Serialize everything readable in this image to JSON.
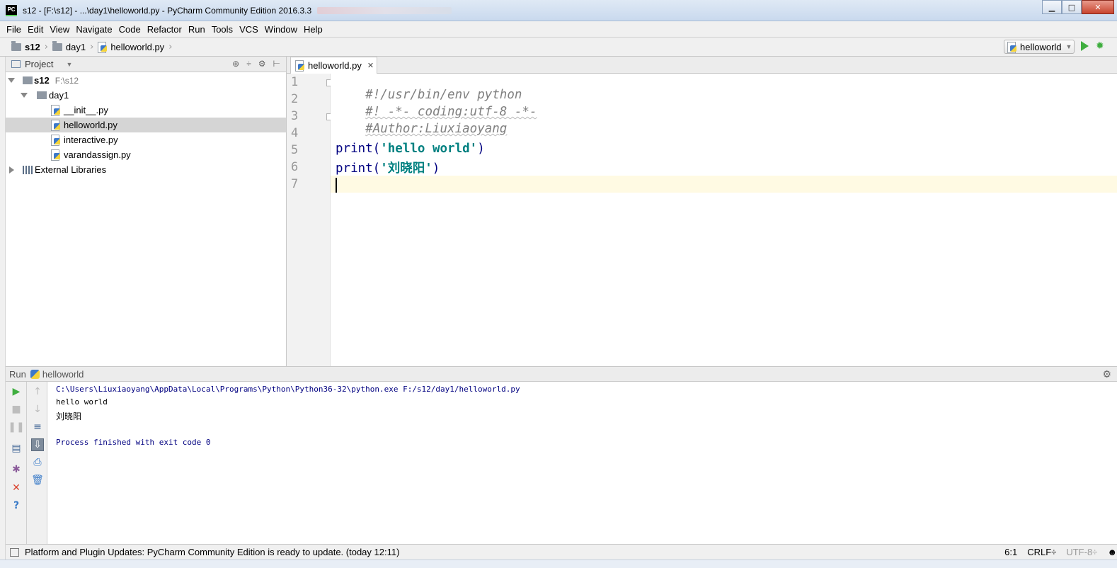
{
  "window": {
    "title": "s12 - [F:\\s12] - ...\\day1\\helloworld.py - PyCharm Community Edition 2016.3.3",
    "app_icon_text": "PC",
    "minimize": "▁",
    "maximize": "□",
    "close": "✕"
  },
  "menu": [
    "File",
    "Edit",
    "View",
    "Navigate",
    "Code",
    "Refactor",
    "Run",
    "Tools",
    "VCS",
    "Window",
    "Help"
  ],
  "breadcrumb": [
    "s12",
    "day1",
    "helloworld.py"
  ],
  "run_config": {
    "name": "helloworld"
  },
  "project": {
    "header": "Project",
    "root_name": "s12",
    "root_path": "F:\\s12",
    "folder": "day1",
    "files": [
      "__init__.py",
      "helloworld.py",
      "interactive.py",
      "varandassign.py"
    ],
    "selected_file": "helloworld.py",
    "external": "External Libraries"
  },
  "editor": {
    "tab_label": "helloworld.py",
    "line_numbers": [
      "1",
      "2",
      "3",
      "4",
      "5",
      "6",
      "7"
    ],
    "lines": {
      "l1": "#!/usr/bin/env python",
      "l2": "#! -*- coding:utf-8 -*-",
      "l3": "#Author:Liuxiaoyang",
      "l5_fn": "print(",
      "l5_str": "'hello world'",
      "l5_end": ")",
      "l6_fn": "print(",
      "l6_str": "'刘晓阳'",
      "l6_end": ")"
    }
  },
  "run_panel": {
    "label": "Run",
    "config": "helloworld",
    "console": [
      "C:\\Users\\Liuxiaoyang\\AppData\\Local\\Programs\\Python\\Python36-32\\python.exe F:/s12/day1/helloworld.py",
      "hello world",
      "刘晓阳",
      "Process finished with exit code 0"
    ]
  },
  "status": {
    "message": "Platform and Plugin Updates: PyCharm Community Edition is ready to update. (today 12:11)",
    "position": "6:1",
    "line_sep": "CRLF÷",
    "encoding": "UTF-8÷"
  },
  "colors": {
    "run_green": "#3fae3f",
    "comment": "#808080",
    "keyword": "#000080",
    "string": "#008080",
    "caret_row": "#fffae3"
  }
}
